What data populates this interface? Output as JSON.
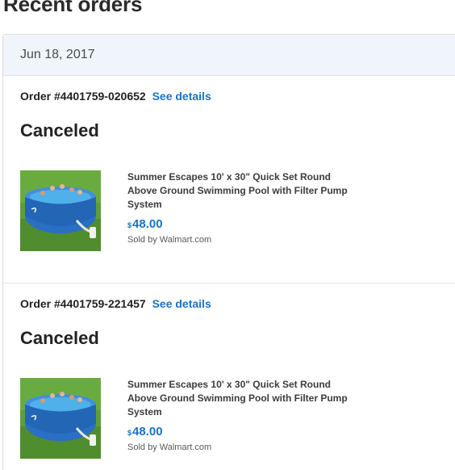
{
  "page_title": "Recent orders",
  "order_group": {
    "date": "Jun 18, 2017",
    "orders": [
      {
        "order_label": "Order #4401759-020652",
        "details_link": "See details",
        "status": "Canceled",
        "item": {
          "name": "Summer Escapes 10' x 30\" Quick Set Round Above Ground Swimming Pool with Filter Pump System",
          "price_currency": "$",
          "price_amount": "48.00",
          "sold_by": "Sold by Walmart.com",
          "thumbnail_icon": "swimming-pool-product-image"
        }
      },
      {
        "order_label": "Order #4401759-221457",
        "details_link": "See details",
        "status": "Canceled",
        "item": {
          "name": "Summer Escapes 10' x 30\" Quick Set Round Above Ground Swimming Pool with Filter Pump System",
          "price_currency": "$",
          "price_amount": "48.00",
          "sold_by": "Sold by Walmart.com",
          "thumbnail_icon": "swimming-pool-product-image"
        }
      }
    ]
  },
  "colors": {
    "link": "#1a72c4",
    "header_bg": "#f0f5fb",
    "border": "#dde3ea"
  }
}
